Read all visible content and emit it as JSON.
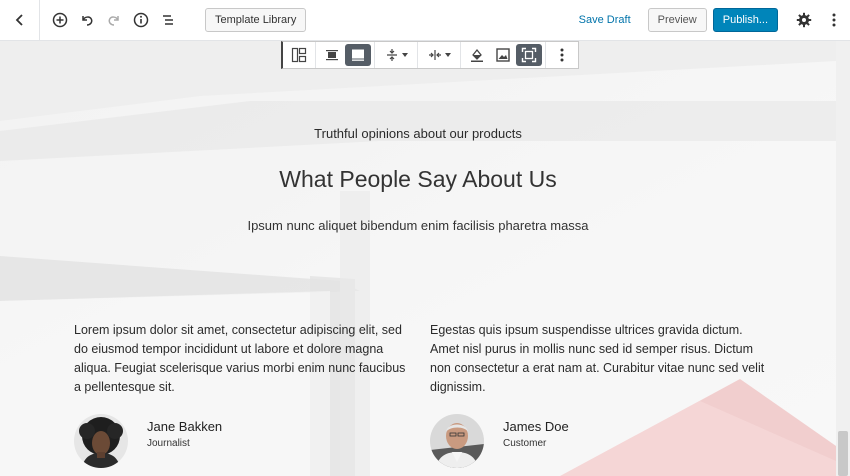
{
  "topbar": {
    "template_library_label": "Template Library",
    "save_draft_label": "Save Draft",
    "preview_label": "Preview",
    "publish_label": "Publish...",
    "icons": [
      "arrow-left-icon",
      "add-block-icon",
      "undo-icon",
      "redo-icon",
      "info-icon",
      "outline-list-icon",
      "gear-icon",
      "more-vertical-icon"
    ]
  },
  "block_toolbar": {
    "icons": [
      "layout-switch-icon",
      "align-center-icon",
      "align-wide-icon",
      "vertical-align-icon",
      "horizontal-align-icon",
      "fill-color-icon",
      "media-icon",
      "fullscreen-icon",
      "more-vertical-icon"
    ]
  },
  "section": {
    "eyebrow": "Truthful opinions about our products",
    "heading": "What People Say About Us",
    "subheading": "Ipsum nunc aliquet bibendum enim facilisis pharetra massa"
  },
  "testimonials": [
    {
      "quote": "Lorem ipsum dolor sit amet, consectetur adipiscing elit, sed do eiusmod tempor incididunt ut labore et dolore magna aliqua. Feugiat scelerisque varius morbi enim nunc faucibus a pellentesque sit.",
      "name": "Jane Bakken",
      "role": "Journalist"
    },
    {
      "quote": "Egestas quis ipsum suspendisse ultrices gravida dictum. Amet nisl purus in mollis nunc sed id semper risus. Dictum non consectetur a erat nam at. Curabitur vitae nunc sed velit dignissim.",
      "name": "James Doe",
      "role": "Customer"
    }
  ],
  "colors": {
    "accent": "#0085ba",
    "link": "#0073aa",
    "toolbar_active": "#555d66",
    "background_pink": "#f2c9c9"
  }
}
